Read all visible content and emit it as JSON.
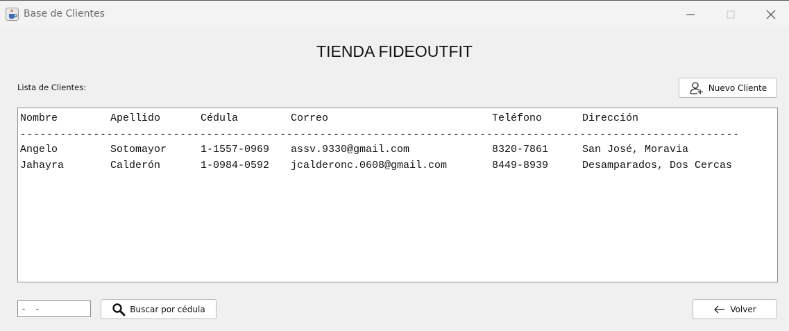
{
  "window": {
    "title": "Base de Clientes",
    "app_icon": "java-cup-icon"
  },
  "header": {
    "store_title": "TIENDA FIDEOUTFIT"
  },
  "list": {
    "label": "Lista de Clientes:",
    "new_client_label": "Nuevo Cliente",
    "new_client_icon": "add-user-icon",
    "columns": [
      "Nombre",
      "Apellido",
      "Cédula",
      "Correo",
      "Teléfono",
      "Dirección"
    ],
    "separator": "------------------------------------------------------------------------------------------------------------",
    "rows": [
      [
        "Angelo",
        "Sotomayor",
        "1-1557-0969",
        "assv.9330@gmail.com",
        "8320-7861",
        "San José, Moravia"
      ],
      [
        "Jahayra",
        "Calderón",
        "1-0984-0592",
        "jcalderonc.0608@gmail.com",
        "8449-8939",
        "Desamparados, Dos Cercas"
      ]
    ]
  },
  "search": {
    "cedula_value": "-    -",
    "button_label": "Buscar por cédula",
    "icon": "search-icon"
  },
  "footer": {
    "back_label": "Volver",
    "back_icon": "arrow-left-icon"
  }
}
